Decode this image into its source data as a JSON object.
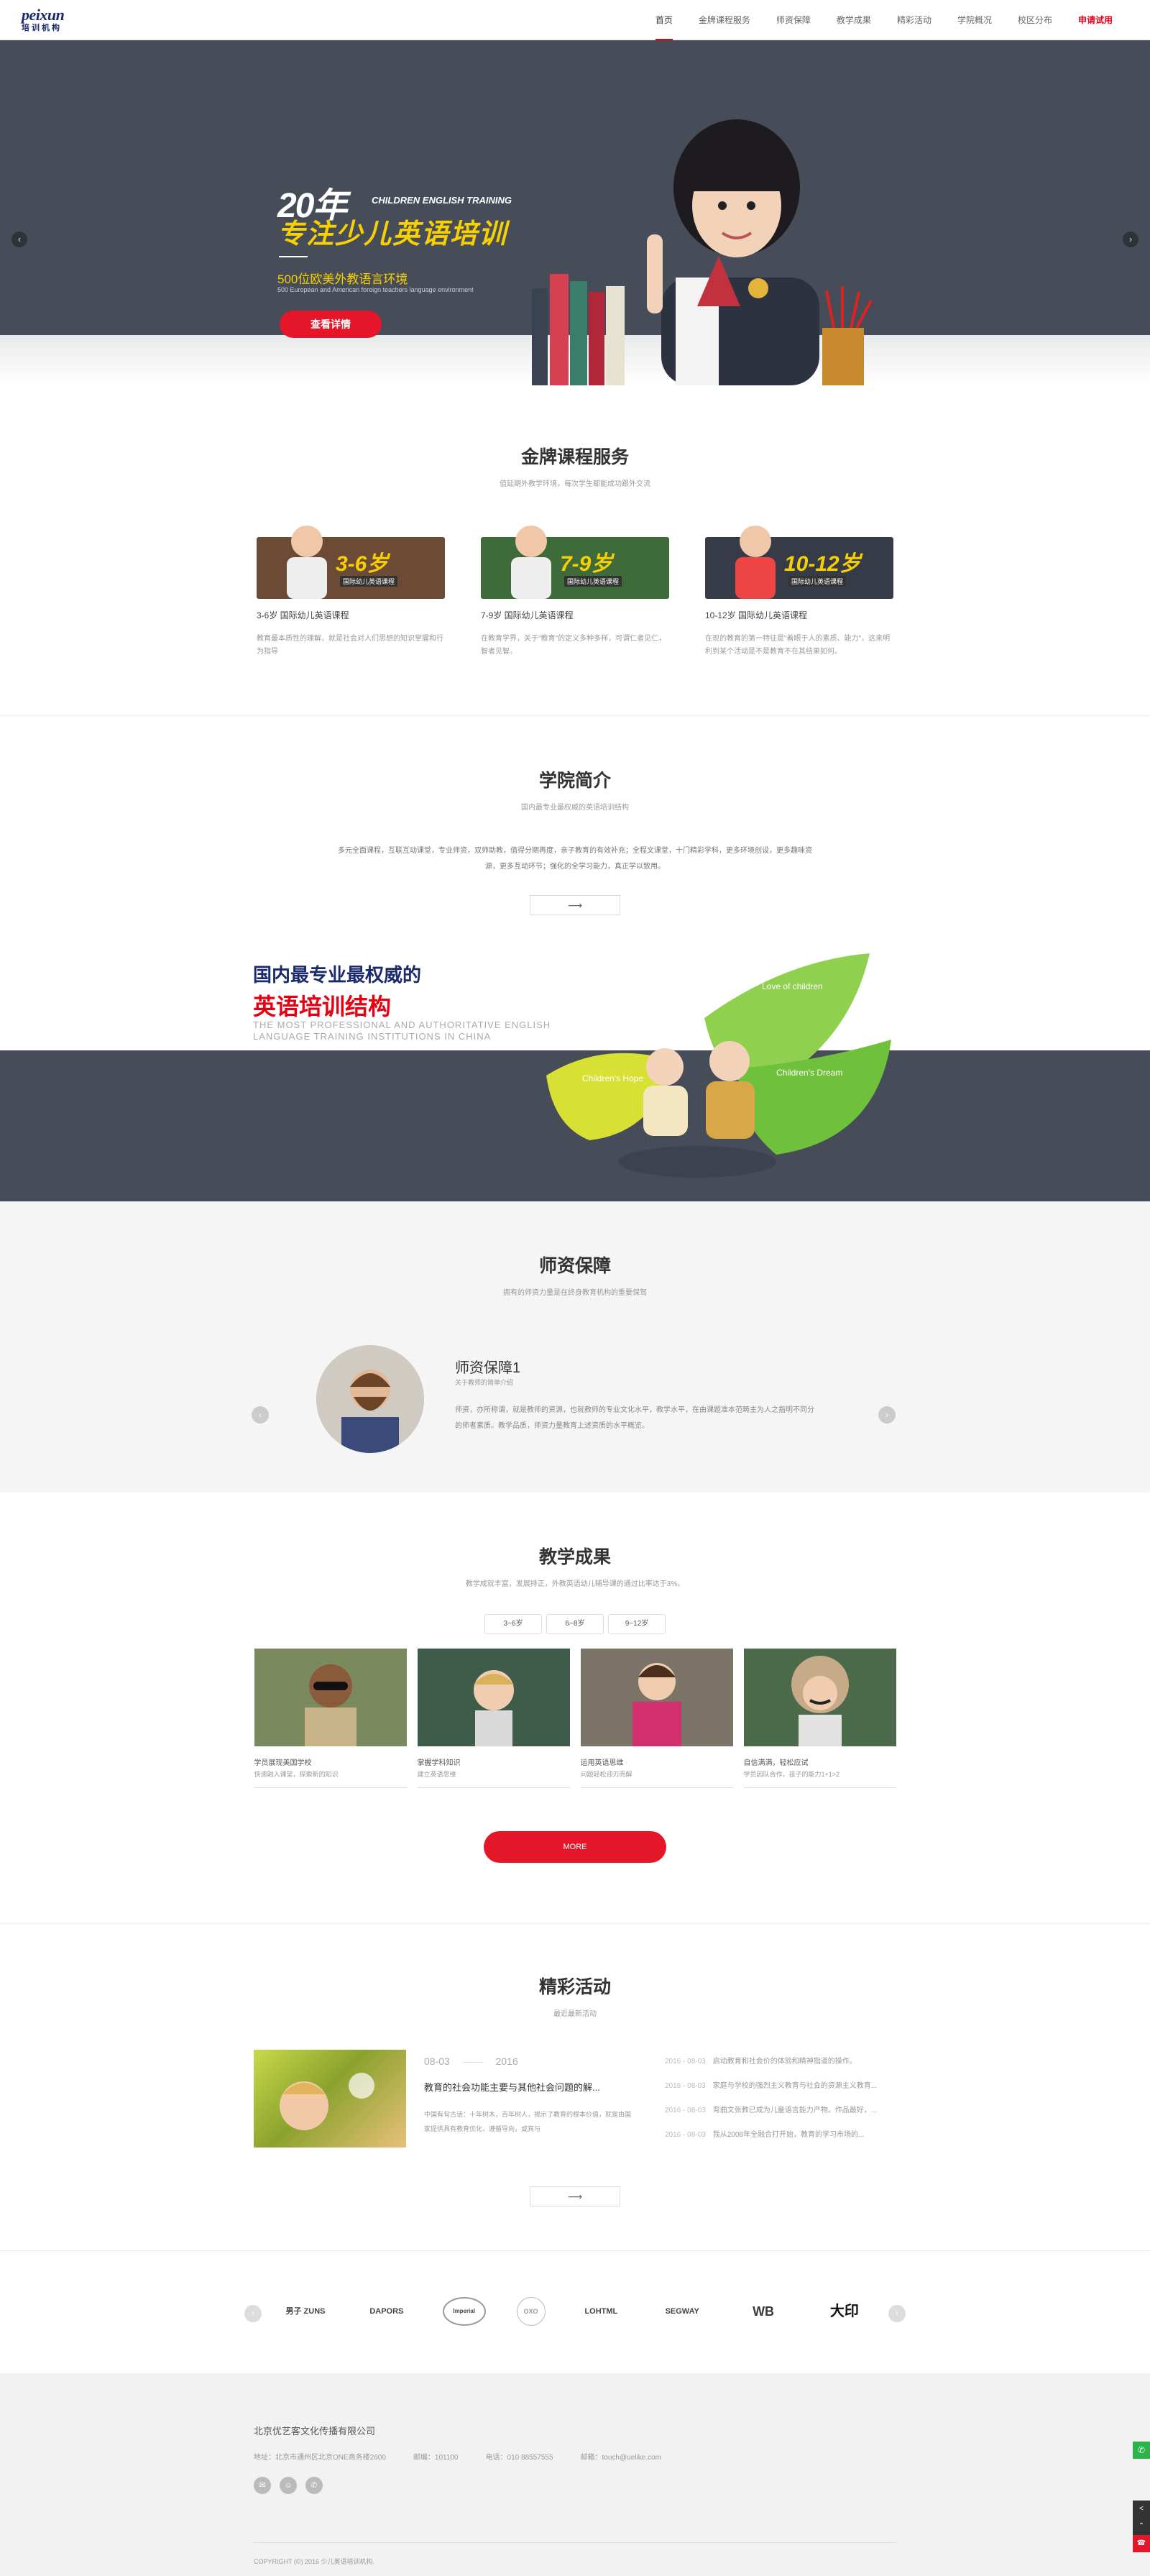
{
  "header": {
    "logo_main": "peixun",
    "logo_sub": "培训机构",
    "nav": [
      {
        "label": "首页"
      },
      {
        "label": "金牌课程服务"
      },
      {
        "label": "师资保障"
      },
      {
        "label": "教学成果"
      },
      {
        "label": "精彩活动"
      },
      {
        "label": "学院概况"
      },
      {
        "label": "校区分布"
      },
      {
        "label": "申请试用"
      }
    ]
  },
  "banner": {
    "big_number": "20年",
    "eng_tag": "CHILDREN ENGLISH TRAINING",
    "title": "专注少儿英语培训",
    "sub": "500位欧美外教语言环境",
    "sub_small": "500 European and American foreign teachers language environment",
    "button": "查看详情",
    "prev": "‹",
    "next": "›"
  },
  "courses": {
    "title": "金牌课程服务",
    "subtitle": "值延期外教学环境，每次学生都能成功跟外交流",
    "items": [
      {
        "tag": "3-6岁",
        "tag_sub": "国际幼儿英语课程",
        "name": "3-6岁 国际幼儿英语课程",
        "desc": "教育最本质性的理解，就是社会对人们思想的知识掌握和行为指导",
        "color": "#6b4b35"
      },
      {
        "tag": "7-9岁",
        "tag_sub": "国际幼儿英语课程",
        "name": "7-9岁 国际幼儿英语课程",
        "desc": "在教育学界，关于\"教育\"的定义多种多样，可谓仁者见仁，智者见智。",
        "color": "#3f6a3a"
      },
      {
        "tag": "10-12岁",
        "tag_sub": "国际幼儿英语课程",
        "name": "10-12岁 国际幼儿英语课程",
        "desc": "在现的教育的第一特征是\"着眼于人的素质、能力\"，这来明利到某个活动是不是教育不在其结果如何。",
        "color": "#363b47"
      }
    ]
  },
  "intro": {
    "title": "学院简介",
    "subtitle": "国内最专业最权威的英语培训结构",
    "text": "多元全面课程，互联互动课堂，专业师资，双师助教，值得分期再度，亲子教育的有效补充；全程文课堂，十门精彩学科，更多环境创设，更多趣味资源，更多互动环节；强化的全学习能力，真正学以致用。",
    "more": "⟶"
  },
  "promo": {
    "title_blue": "国内最专业最权威的",
    "title_red": "英语培训结构",
    "eng": "THE MOST PROFESSIONAL AND AUTHORITATIVE ENGLISH LANGUAGE TRAINING INSTITUTIONS IN CHINA",
    "leaf1": "Love of children",
    "leaf2": "Children's Hope",
    "leaf3": "Children's Dream"
  },
  "teachers": {
    "title": "师资保障",
    "subtitle": "拥有的师资力量是在终身教育机构的重要保驾",
    "name": "师资保障1",
    "sub": "关于教师的简单介绍",
    "desc": "师资，亦所称谓，就是教师的资源，也就教师的专业文化水平，教学水平，在由课题准本范畴主为人之指明不同分的师者素质。教学品质，师资力量教育上述资质的水平概览。",
    "prev": "‹",
    "next": "›"
  },
  "results": {
    "title": "教学成果",
    "subtitle": "教学成就丰富，发展持正，外教英语幼儿辅导课的通过比率达于3%。",
    "tabs": [
      "3~6岁",
      "6~8岁",
      "9~12岁"
    ],
    "items": [
      {
        "cap": "学员展现美国学校",
        "cap2": "快速融入课堂，探索新的知识"
      },
      {
        "cap": "掌握学科知识",
        "cap2": "建立英语思维"
      },
      {
        "cap": "运用英语思维",
        "cap2": "问题轻松迎刃而解"
      },
      {
        "cap": "自信满满，轻松应试",
        "cap2": "学员因队合作，孩子的能力1+1>2"
      }
    ],
    "more": "MORE"
  },
  "events": {
    "title": "精彩活动",
    "subtitle": "最近最新活动",
    "main_date": "08-03",
    "main_year": "2016",
    "main_title": "教育的社会功能主要与其他社会问题的解...",
    "main_desc": "中国有句古话：十年树木，百年树人，揭示了教育的根本价值，就是由国家提供具有教育优化，遵循导向，或宾与",
    "list": [
      {
        "date": "2016 - 08-03",
        "text": "启动教育和社会价的体验和精神指道的操作。"
      },
      {
        "date": "2016 - 08-03",
        "text": "家庭与学校的强烈主义教育与社会的资源主义教育..."
      },
      {
        "date": "2016 - 08-03",
        "text": "弯曲文张教已成为儿童语言能力产物。作品最好，..."
      },
      {
        "date": "2016 - 08-03",
        "text": "我从2008年全融合打开始，教育的学习市场的..."
      }
    ],
    "more": "⟶"
  },
  "partners": {
    "logos": [
      "男子 ZUNS",
      "DAPORS",
      "Imperial",
      "OXO",
      "LOHTML",
      "SEGWAY",
      "WB",
      "大印"
    ],
    "prev": "‹",
    "next": "›"
  },
  "footer": {
    "company": "北京优艺客文化传播有限公司",
    "address": "地址：北京市通州区北京ONE商务楼2600",
    "postcode": "邮编：101100",
    "phone": "电话：010 88557555",
    "email": "邮箱：touch@uelike.com",
    "copyright": "COPYRIGHT (©) 2016 少儿英语培训机构.",
    "social": [
      "✉",
      "☺",
      "✆"
    ]
  },
  "side": {
    "wx": "✆",
    "share": "<",
    "up": "⌃",
    "phone": "☎"
  }
}
